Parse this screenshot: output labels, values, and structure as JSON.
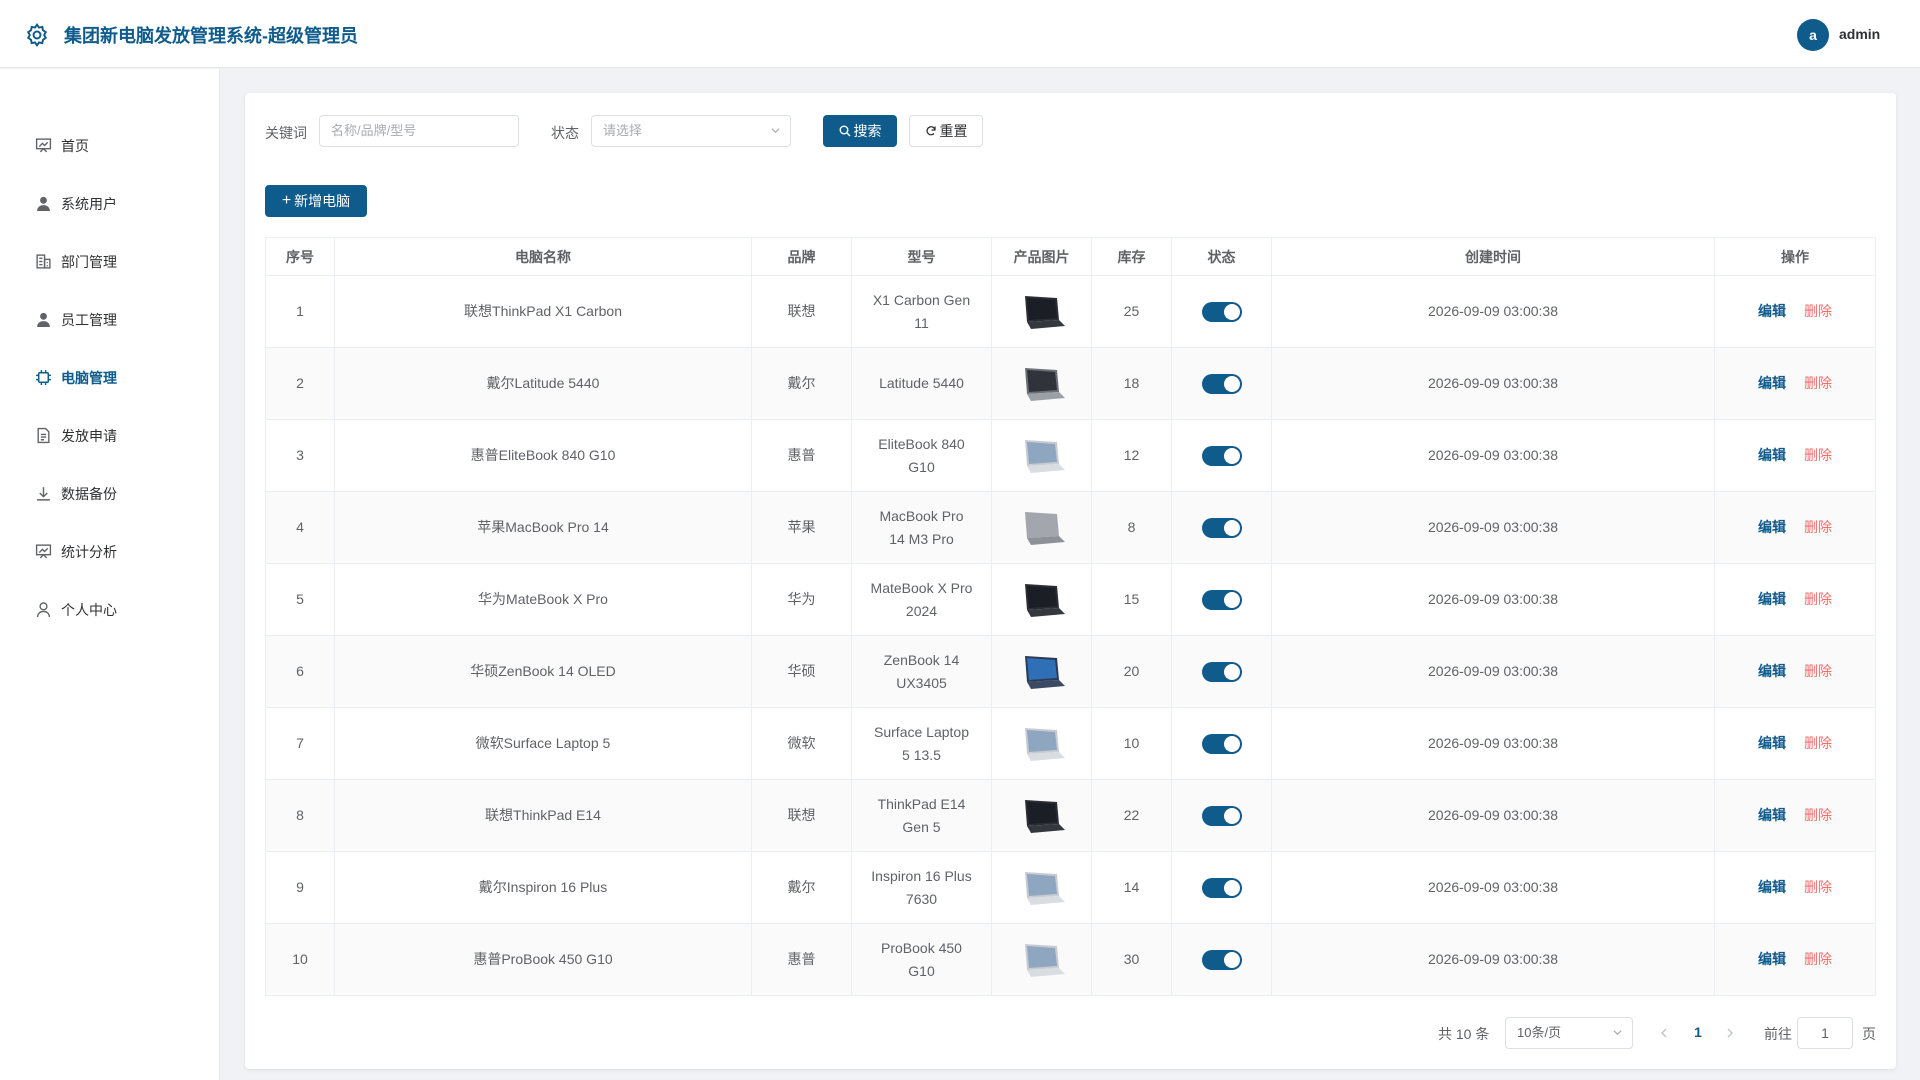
{
  "app": {
    "title": "集团新电脑发放管理系统-超级管理员"
  },
  "user": {
    "avatar_letter": "a",
    "name": "admin"
  },
  "colors": {
    "primary": "#0f5c8c",
    "danger": "#f56c6c",
    "text": "#606266"
  },
  "sidebar": {
    "items": [
      {
        "label": "首页",
        "icon": "dashboard-icon",
        "active": false
      },
      {
        "label": "系统用户",
        "icon": "user-icon",
        "active": false
      },
      {
        "label": "部门管理",
        "icon": "building-icon",
        "active": false
      },
      {
        "label": "员工管理",
        "icon": "user-icon",
        "active": false
      },
      {
        "label": "电脑管理",
        "icon": "cpu-icon",
        "active": true
      },
      {
        "label": "发放申请",
        "icon": "document-icon",
        "active": false
      },
      {
        "label": "数据备份",
        "icon": "download-icon",
        "active": false
      },
      {
        "label": "统计分析",
        "icon": "chart-icon",
        "active": false
      },
      {
        "label": "个人中心",
        "icon": "user-outline-icon",
        "active": false
      }
    ]
  },
  "filter": {
    "keyword_label": "关键词",
    "keyword_placeholder": "名称/品牌/型号",
    "status_label": "状态",
    "status_placeholder": "请选择",
    "search_label": "搜索",
    "reset_label": "重置"
  },
  "toolbar": {
    "add_label": "新增电脑"
  },
  "table": {
    "headers": [
      "序号",
      "电脑名称",
      "品牌",
      "型号",
      "产品图片",
      "库存",
      "状态",
      "创建时间",
      "操作"
    ],
    "edit_label": "编辑",
    "delete_label": "删除",
    "rows": [
      {
        "no": "1",
        "name": "联想ThinkPad X1 Carbon",
        "brand": "联想",
        "model": "X1 Carbon Gen 11",
        "stock": "25",
        "enabled": true,
        "created": "2026-09-09 03:00:38",
        "image": "laptop-dark-icon"
      },
      {
        "no": "2",
        "name": "戴尔Latitude 5440",
        "brand": "戴尔",
        "model": "Latitude 5440",
        "stock": "18",
        "enabled": true,
        "created": "2026-09-09 03:00:38",
        "image": "laptop-gray-icon"
      },
      {
        "no": "3",
        "name": "惠普EliteBook 840 G10",
        "brand": "惠普",
        "model": "EliteBook 840 G10",
        "stock": "12",
        "enabled": true,
        "created": "2026-09-09 03:00:38",
        "image": "laptop-silver-icon"
      },
      {
        "no": "4",
        "name": "苹果MacBook Pro 14",
        "brand": "苹果",
        "model": "MacBook Pro 14 M3 Pro",
        "stock": "8",
        "enabled": true,
        "created": "2026-09-09 03:00:38",
        "image": "laptop-closed-icon"
      },
      {
        "no": "5",
        "name": "华为MateBook X Pro",
        "brand": "华为",
        "model": "MateBook X Pro 2024",
        "stock": "15",
        "enabled": true,
        "created": "2026-09-09 03:00:38",
        "image": "laptop-dark-icon"
      },
      {
        "no": "6",
        "name": "华硕ZenBook 14 OLED",
        "brand": "华硕",
        "model": "ZenBook 14 UX3405",
        "stock": "20",
        "enabled": true,
        "created": "2026-09-09 03:00:38",
        "image": "laptop-blue-icon"
      },
      {
        "no": "7",
        "name": "微软Surface Laptop 5",
        "brand": "微软",
        "model": "Surface Laptop 5 13.5",
        "stock": "10",
        "enabled": true,
        "created": "2026-09-09 03:00:38",
        "image": "laptop-silver-icon"
      },
      {
        "no": "8",
        "name": "联想ThinkPad E14",
        "brand": "联想",
        "model": "ThinkPad E14 Gen 5",
        "stock": "22",
        "enabled": true,
        "created": "2026-09-09 03:00:38",
        "image": "laptop-dark-icon"
      },
      {
        "no": "9",
        "name": "戴尔Inspiron 16 Plus",
        "brand": "戴尔",
        "model": "Inspiron 16 Plus 7630",
        "stock": "14",
        "enabled": true,
        "created": "2026-09-09 03:00:38",
        "image": "laptop-silver-icon"
      },
      {
        "no": "10",
        "name": "惠普ProBook 450 G10",
        "brand": "惠普",
        "model": "ProBook 450 G10",
        "stock": "30",
        "enabled": true,
        "created": "2026-09-09 03:00:38",
        "image": "laptop-silver-icon"
      }
    ]
  },
  "pagination": {
    "total_label": "共 10 条",
    "page_size_label": "10条/页",
    "current_page": "1",
    "goto_label": "前往",
    "goto_value": "1",
    "page_unit": "页"
  }
}
